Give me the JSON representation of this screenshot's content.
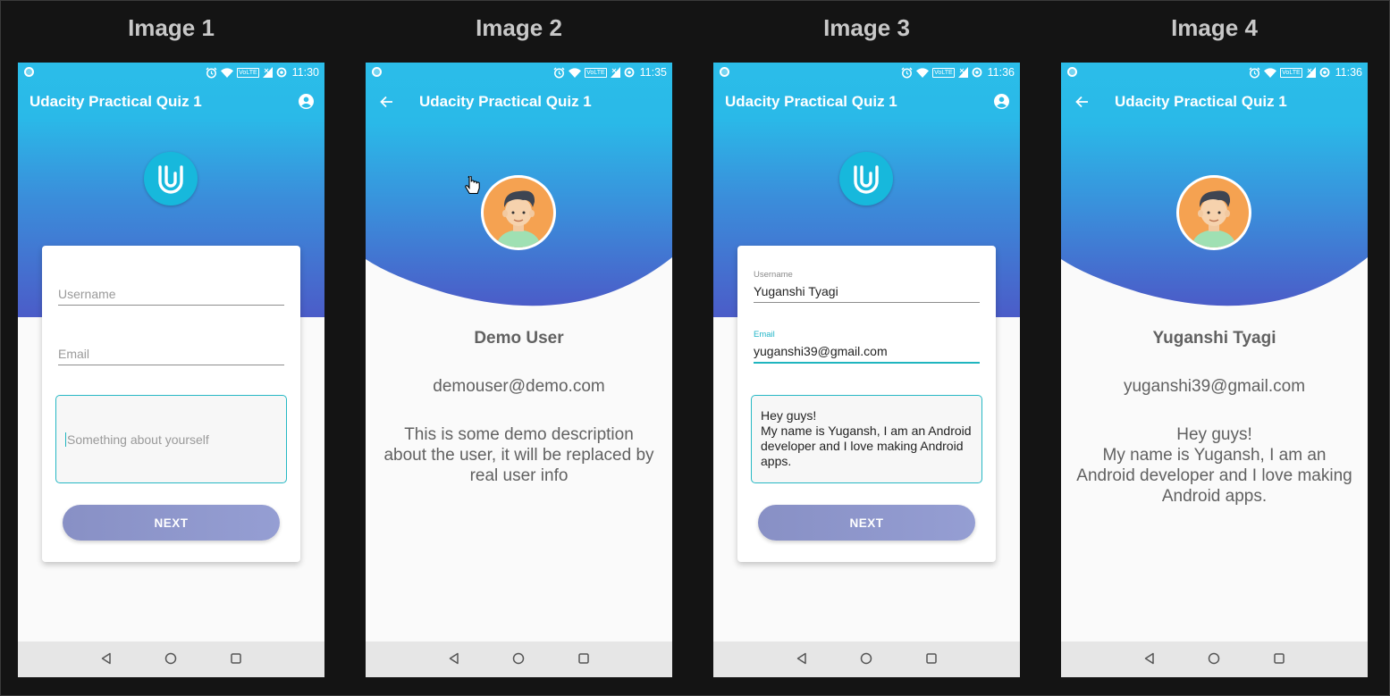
{
  "captions": [
    "Image 1",
    "Image 2",
    "Image 3",
    "Image 4"
  ],
  "app_title": "Udacity Practical Quiz 1",
  "colors": {
    "primary_top": "#2bbde9",
    "primary_bottom": "#4b5cc8",
    "accent_teal": "#1fb5bf",
    "button": "#8890c5",
    "background": "#141414"
  },
  "screens": [
    {
      "time": "11:30",
      "appbar_icon": "account-circle-icon",
      "form": {
        "username_placeholder": "Username",
        "email_placeholder": "Email",
        "about_placeholder": "Something about yourself",
        "next_label": "NEXT"
      }
    },
    {
      "time": "11:35",
      "appbar_icon": "back-arrow-icon",
      "profile": {
        "name": "Demo User",
        "email": "demouser@demo.com",
        "description": "This is some demo description about the user, it will be replaced by real user info"
      }
    },
    {
      "time": "11:36",
      "appbar_icon": "account-circle-icon",
      "form": {
        "username_label": "Username",
        "username_value": "Yuganshi Tyagi",
        "email_label": "Email",
        "email_value": "yuganshi39@gmail.com",
        "about_value": "Hey guys!\nMy name is Yugansh, I am an Android developer and I love making Android apps.",
        "next_label": "NEXT"
      }
    },
    {
      "time": "11:36",
      "appbar_icon": "back-arrow-icon",
      "profile": {
        "name": "Yuganshi Tyagi",
        "email": "yuganshi39@gmail.com",
        "description": "Hey guys!\nMy name is Yugansh, I am an Android developer and I love making Android apps."
      }
    }
  ]
}
